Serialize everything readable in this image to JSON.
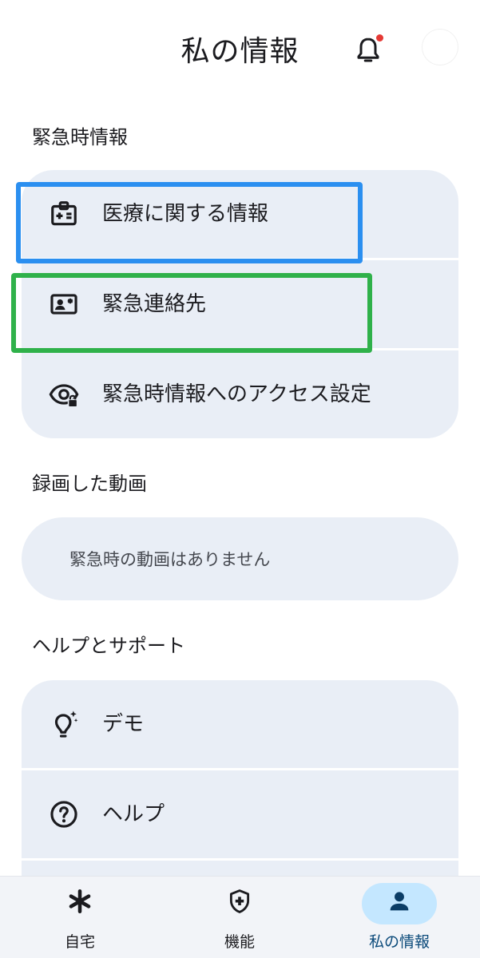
{
  "header": {
    "title": "私の情報",
    "notification_dot_color": "#e53935"
  },
  "emergency": {
    "section_title": "緊急時情報",
    "items": [
      {
        "label": "医療に関する情報",
        "icon": "medical-id-icon"
      },
      {
        "label": "緊急連絡先",
        "icon": "contact-card-icon"
      },
      {
        "label": "緊急時情報へのアクセス設定",
        "icon": "eye-lock-icon"
      }
    ]
  },
  "videos": {
    "section_title": "録画した動画",
    "empty_text": "緊急時の動画はありません"
  },
  "help": {
    "section_title": "ヘルプとサポート",
    "items": [
      {
        "label": "デモ",
        "icon": "lightbulb-icon"
      },
      {
        "label": "ヘルプ",
        "icon": "help-circle-icon"
      }
    ]
  },
  "bottom_nav": {
    "items": [
      {
        "label": "自宅",
        "icon": "asterisk-icon"
      },
      {
        "label": "機能",
        "icon": "shield-plus-icon"
      },
      {
        "label": "私の情報",
        "icon": "person-icon",
        "active": true
      }
    ]
  },
  "colors": {
    "card_bg": "#e9eef6",
    "active_pill": "#c4e7ff",
    "highlight_blue": "#2b8ff0",
    "highlight_green": "#2fb14a"
  }
}
